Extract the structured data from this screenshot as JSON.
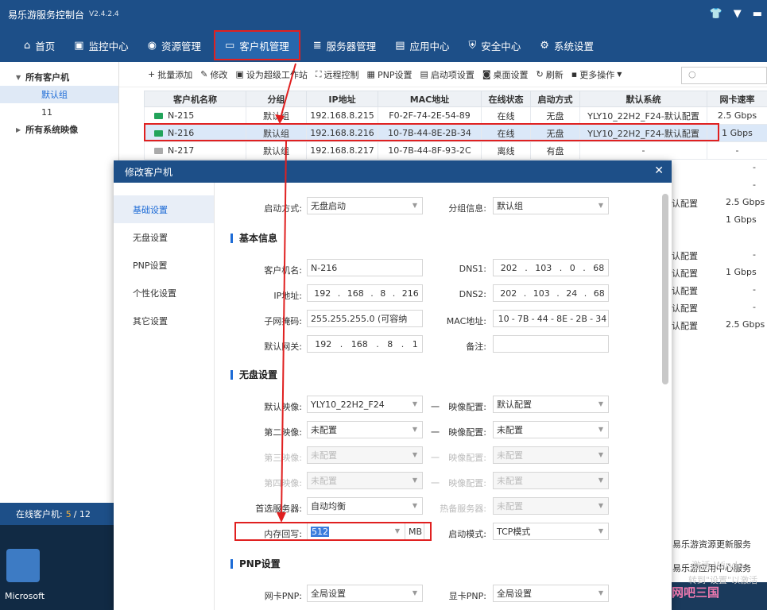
{
  "title": {
    "name": "易乐游服务控制台",
    "version": "V2.4.2.4"
  },
  "nav": [
    "首页",
    "监控中心",
    "资源管理",
    "客户机管理",
    "服务器管理",
    "应用中心",
    "安全中心",
    "系统设置"
  ],
  "tree": {
    "root": "所有客户机",
    "child1": "默认组",
    "child2": "11",
    "root2": "所有系统映像"
  },
  "bottom": {
    "label": "在线客户机:",
    "online": "5",
    "total": "/ 12"
  },
  "desktop": {
    "label": "Microsoft"
  },
  "toolbar": [
    "批量添加",
    "修改",
    "设为超级工作站",
    "远程控制",
    "PNP设置",
    "启动项设置",
    "桌面设置",
    "刷新",
    "更多操作"
  ],
  "table": {
    "headers": [
      "客户机名称",
      "分组",
      "IP地址",
      "MAC地址",
      "在线状态",
      "启动方式",
      "默认系统",
      "网卡速率"
    ],
    "rows": [
      {
        "name": "N-215",
        "group": "默认组",
        "ip": "192.168.8.215",
        "mac": "F0-2F-74-2E-54-89",
        "status": "在线",
        "boot": "无盘",
        "sys": "YLY10_22H2_F24-默认配置",
        "speed": "2.5 Gbps",
        "on": true
      },
      {
        "name": "N-216",
        "group": "默认组",
        "ip": "192.168.8.216",
        "mac": "10-7B-44-8E-2B-34",
        "status": "在线",
        "boot": "无盘",
        "sys": "YLY10_22H2_F24-默认配置",
        "speed": "1 Gbps",
        "on": true
      },
      {
        "name": "N-217",
        "group": "默认组",
        "ip": "192.168.8.217",
        "mac": "10-7B-44-8F-93-2C",
        "status": "离线",
        "boot": "有盘",
        "sys": "-",
        "speed": "-",
        "on": false
      }
    ]
  },
  "rightcol": [
    "-",
    "-",
    "认配置",
    "2.5 Gbps",
    "1 Gbps",
    "-",
    "认配置",
    "-",
    "认配置",
    "1 Gbps",
    "认配置",
    "-",
    "认配置",
    "-",
    "认配置",
    "2.5 Gbps"
  ],
  "rightinfo": [
    "易乐游资源更新服务",
    "易乐游应用中心服务",
    "激活 Windo",
    "转到\"设置\"以激活"
  ],
  "watermark": "网吧三国",
  "dialog": {
    "title": "修改客户机",
    "tabs": [
      "基础设置",
      "无盘设置",
      "PNP设置",
      "个性化设置",
      "其它设置"
    ],
    "boot_label": "启动方式:",
    "boot_value": "无盘启动",
    "group_label": "分组信息:",
    "group_value": "默认组",
    "sec_basic": "基本信息",
    "name_label": "客户机名:",
    "name_value": "N-216",
    "dns1_label": "DNS1:",
    "dns1": [
      "202",
      "103",
      "0",
      "68"
    ],
    "ip_label": "IP地址:",
    "ip": [
      "192",
      "168",
      "8",
      "216"
    ],
    "dns2_label": "DNS2:",
    "dns2": [
      "202",
      "103",
      "24",
      "68"
    ],
    "mask_label": "子网掩码:",
    "mask_value": "255.255.255.0  (可容纳",
    "mac_label": "MAC地址:",
    "mac": [
      "10",
      "7B",
      "44",
      "8E",
      "2B",
      "34"
    ],
    "gw_label": "默认网关:",
    "gw": [
      "192",
      "168",
      "8",
      "1"
    ],
    "note_label": "备注:",
    "sec_diskless": "无盘设置",
    "img1_label": "默认映像:",
    "img1": "YLY10_22H2_F24",
    "cfg_label": "映像配置:",
    "cfg1": "默认配置",
    "img2_label": "第二映像:",
    "img2": "未配置",
    "cfg2": "未配置",
    "img3_label": "第三映像:",
    "img3": "未配置",
    "cfg3": "未配置",
    "img4_label": "第四映像:",
    "img4": "未配置",
    "cfg4": "未配置",
    "srv_label": "首选服务器:",
    "srv_value": "自动均衡",
    "hot_label": "热备服务器:",
    "hot_value": "未配置",
    "mem_label": "内存回写:",
    "mem_value": "512",
    "mem_unit": "MB",
    "mode_label": "启动模式:",
    "mode_value": "TCP模式",
    "sec_pnp": "PNP设置",
    "nic_label": "网卡PNP:",
    "nic_value": "全局设置",
    "gpu_label": "显卡PNP:",
    "gpu_value": "全局设置",
    "dash": "一"
  }
}
